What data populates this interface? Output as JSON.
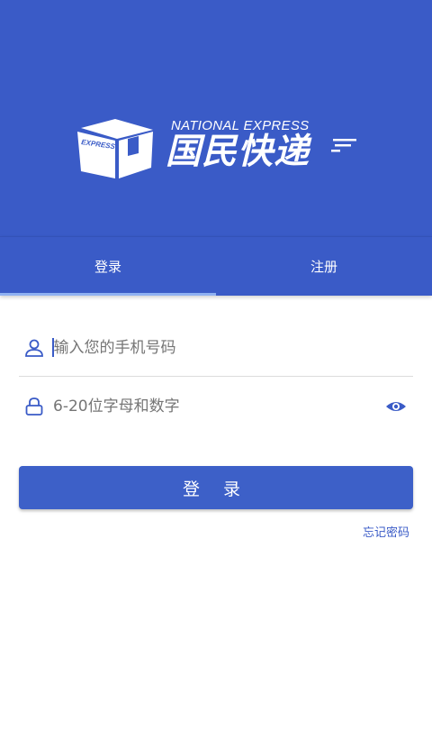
{
  "brand": {
    "box_label": "EXPRESS",
    "english_name": "NATIONAL EXPRESS",
    "chinese_name": "国民快递",
    "color": "#3a5bc7"
  },
  "tabs": [
    {
      "label": "登录",
      "active": true
    },
    {
      "label": "注册",
      "active": false
    }
  ],
  "form": {
    "phone_placeholder": "输入您的手机号码",
    "password_placeholder": "6-20位字母和数字",
    "login_button": "登 录",
    "forgot_password": "忘记密码"
  },
  "icons": {
    "user": "user-icon",
    "lock": "lock-icon",
    "eye": "eye-icon"
  }
}
